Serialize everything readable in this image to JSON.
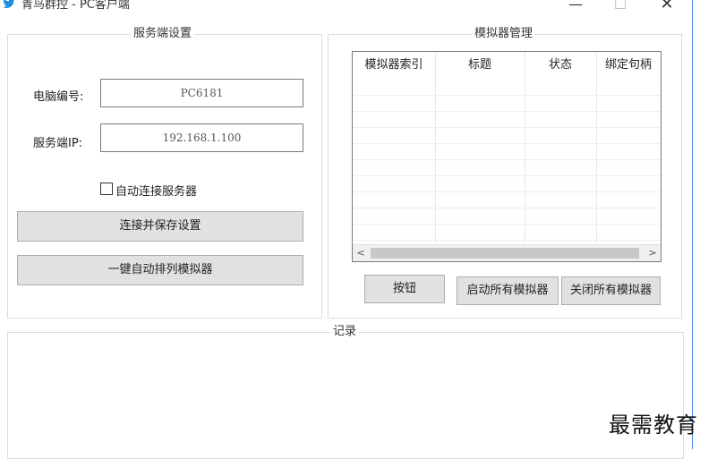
{
  "window": {
    "title": "青鸟群控 - PC客户端",
    "minimize_glyph": "—",
    "maximize_glyph": "☐",
    "close_glyph": "✕",
    "icon": "bird-icon",
    "accent_color": "#3b7ddb"
  },
  "server_settings": {
    "group_title": "服务端设置",
    "computer_id_label": "电脑编号:",
    "computer_id_value": "PC6181",
    "server_ip_label": "服务端IP:",
    "server_ip_value": "192.168.1.100",
    "auto_connect_label": "自动连接服务器",
    "auto_connect_checked": false,
    "connect_save_button": "连接并保存设置",
    "auto_arrange_button": "一键自动排列模拟器"
  },
  "emulator_manager": {
    "group_title": "模拟器管理",
    "columns": [
      "模拟器索引",
      "标题",
      "状态",
      "绑定句柄"
    ],
    "rows": [],
    "scroll_left_glyph": "<",
    "scroll_right_glyph": ">",
    "button_label": "按钮",
    "start_all_button": "启动所有模拟器",
    "close_all_button": "关闭所有模拟器"
  },
  "log": {
    "group_title": "记录"
  },
  "watermark": "最需教育"
}
